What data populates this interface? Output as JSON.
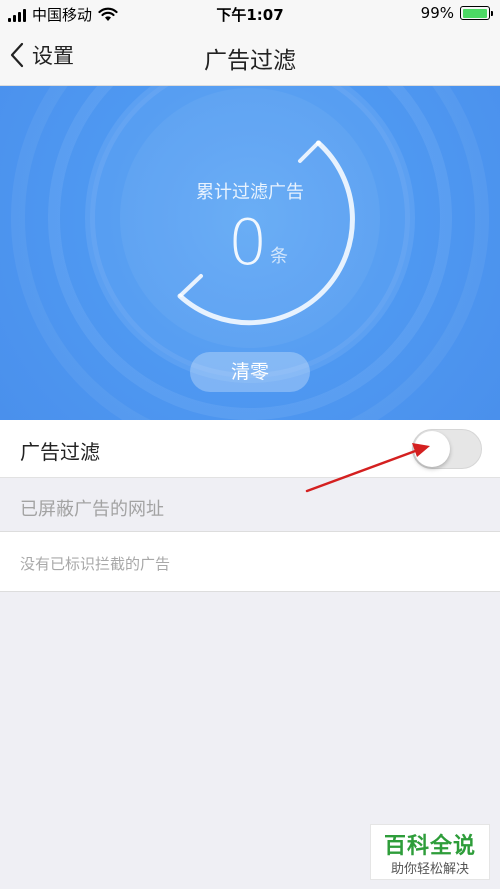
{
  "status_bar": {
    "carrier": "中国移动",
    "time": "下午1:07",
    "battery_percent": "99%",
    "battery_level": 0.99,
    "icons": [
      "signal-icon",
      "wifi-icon",
      "battery-icon"
    ]
  },
  "nav": {
    "back_label": "设置",
    "title": "广告过滤",
    "back_icon": "chevron-left-icon"
  },
  "hero": {
    "counter_label": "累计过滤广告",
    "counter_value": "0",
    "counter_unit": "条",
    "clear_button": "清零",
    "colors": {
      "background": "#4f99f2",
      "text": "#ffffff"
    }
  },
  "settings": {
    "ad_filter_label": "广告过滤",
    "ad_filter_enabled": false
  },
  "blocked": {
    "section_title": "已屏蔽广告的网址",
    "empty_text": "没有已标识拦截的广告"
  },
  "annotation": {
    "arrow_color": "#d42020",
    "icon": "red-arrow-icon"
  },
  "watermark": {
    "title": "百科全说",
    "subtitle": "助你轻松解决",
    "color": "#2e9d3a"
  }
}
